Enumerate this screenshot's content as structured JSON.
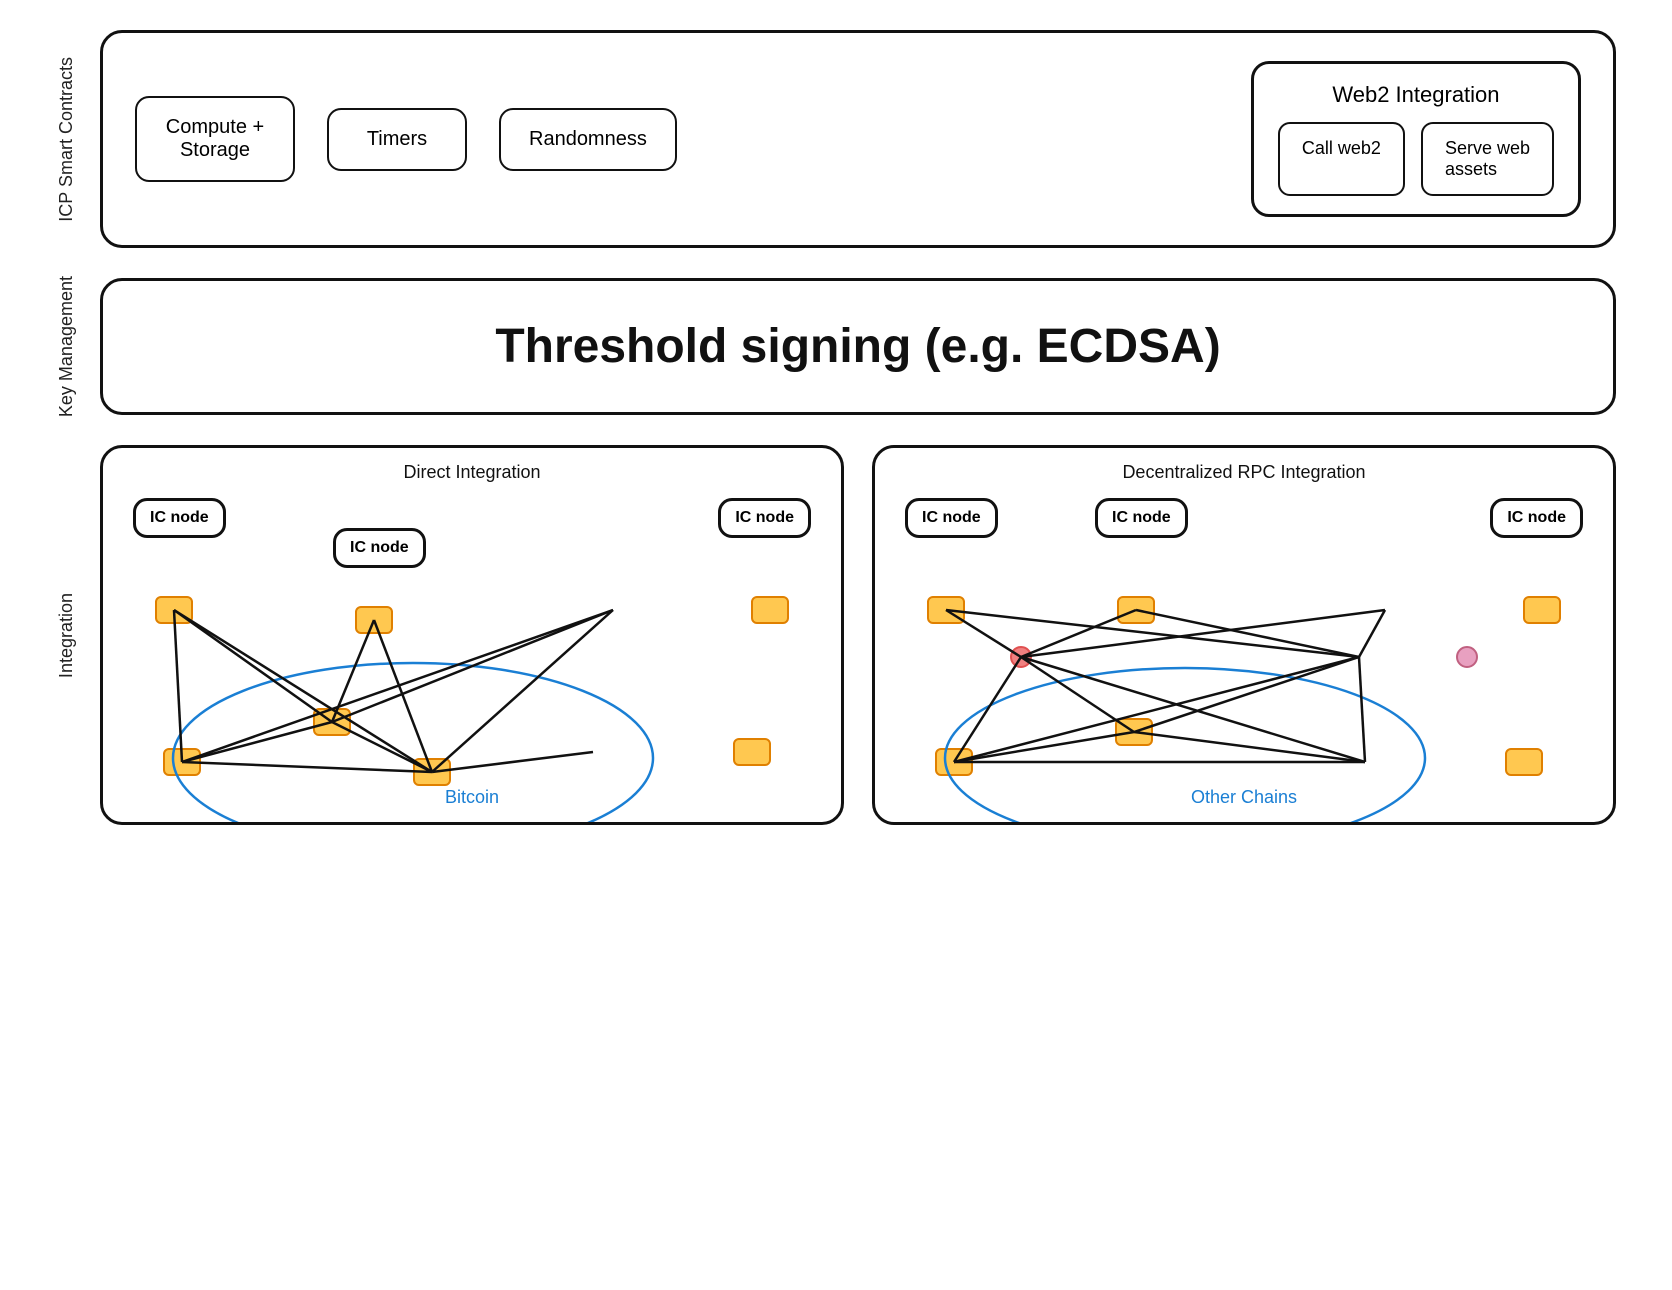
{
  "labels": {
    "icp": "ICP Smart Contracts",
    "keyMgmt": "Key Management",
    "integration": "Integration"
  },
  "icp": {
    "chips": [
      "Compute +\nStorage",
      "Timers",
      "Randomness"
    ],
    "web2": {
      "title": "Web2 Integration",
      "chips": [
        "Call web2",
        "Serve web\nassets"
      ]
    }
  },
  "keyMgmt": {
    "text": "Threshold signing (e.g. ECDSA)"
  },
  "integration": {
    "direct": {
      "label": "Direct Integration",
      "nodes": [
        "IC node",
        "IC node",
        "IC node"
      ],
      "chainLabel": "Bitcoin"
    },
    "rpc": {
      "label": "Decentralized RPC Integration",
      "nodes": [
        "IC node",
        "IC node",
        "IC node"
      ],
      "chainLabel": "Other Chains"
    }
  }
}
